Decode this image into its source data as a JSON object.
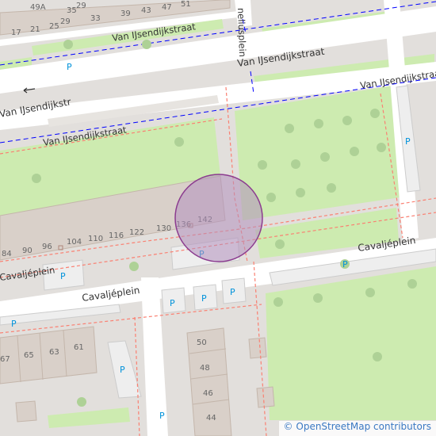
{
  "map": {
    "streets": {
      "van_ijsendijkstraat_north": "Van IJsendijkstraat",
      "van_ijsendijkstraat_main": "Van IJsendijkstraat",
      "van_ijsendijkstraat_west": "Van IJsendijkstr",
      "van_ijsendijkstraat_east": "Van IJsendijkstraat",
      "van_ijsendijkstraat_mid": "Van IJsendijkstraat",
      "cavaljeplein_east": "Cavaljéplein",
      "cavaljeplein_west": "Cavaljéplein",
      "cavaljeplein_far_west": "Cavaljéplein",
      "vertical_street_fragment": "neliusplein"
    },
    "house_numbers": {
      "top_row": [
        "49A",
        "35",
        "29",
        "33",
        "39",
        "43",
        "47",
        "51"
      ],
      "second_row": [
        "17",
        "21",
        "25",
        "29"
      ],
      "building_row": [
        "84",
        "90",
        "96",
        "104",
        "110",
        "116",
        "122",
        "130",
        "136",
        "142"
      ],
      "lower_left": [
        "67",
        "65",
        "63",
        "61"
      ],
      "lower_center": [
        "50",
        "48",
        "46",
        "44"
      ]
    },
    "parking_symbol": "P",
    "colors": {
      "background": "#e2dfdc",
      "road": "#ffffff",
      "grass": "#cdebb0",
      "tree": "#aed196",
      "building": "#d9d0c9",
      "building_outline": "#c4b6ab",
      "bus_route": "#0000ff",
      "footway": "#fa8072",
      "parking_text": "#0092da",
      "marker_fill": "#b28fbd",
      "marker_stroke": "#8b3b8f"
    },
    "marker": "location-circle"
  },
  "attribution": {
    "symbol": "©",
    "text": "OpenStreetMap contributors"
  }
}
